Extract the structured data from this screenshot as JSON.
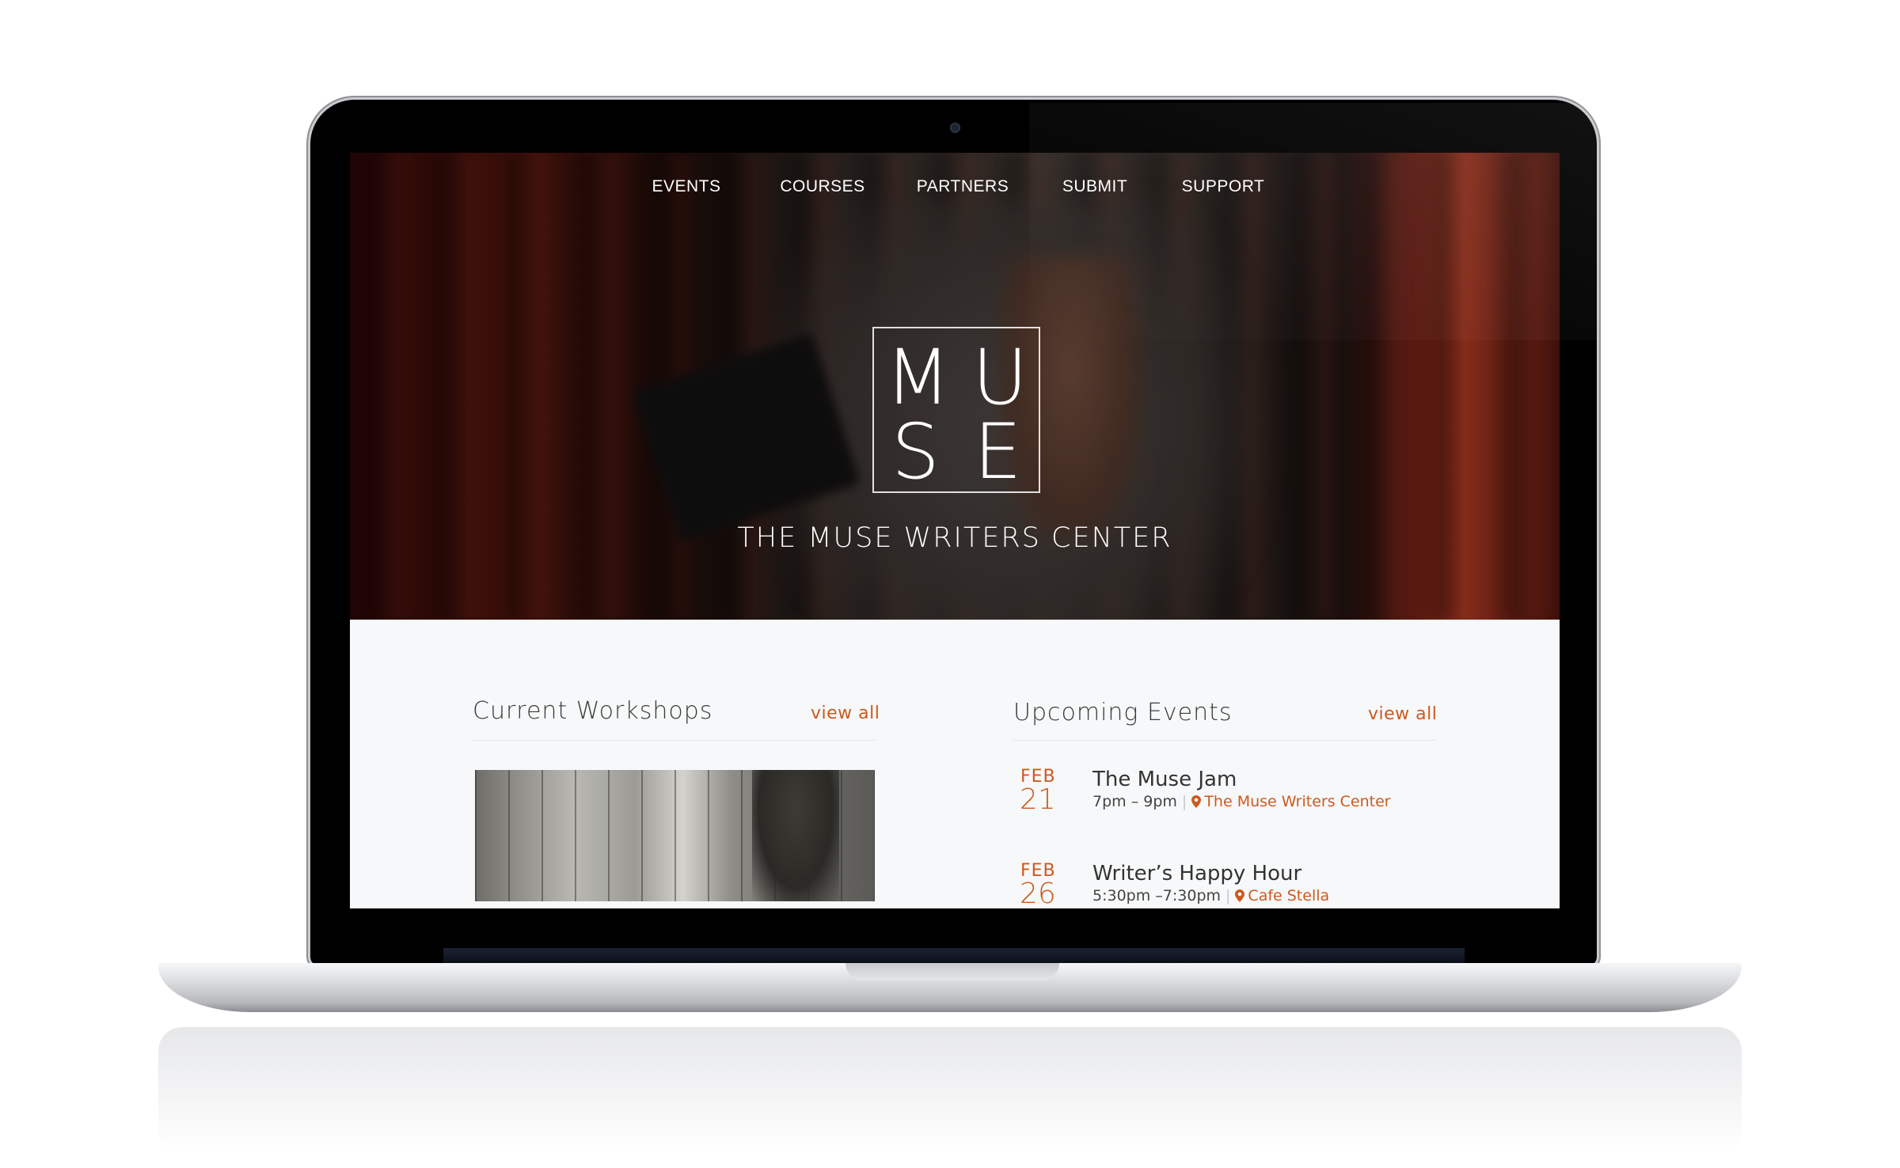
{
  "nav": {
    "items": [
      {
        "label": "EVENTS"
      },
      {
        "label": "COURSES"
      },
      {
        "label": "PARTNERS"
      },
      {
        "label": "SUBMIT"
      },
      {
        "label": "SUPPORT"
      }
    ]
  },
  "hero": {
    "logo_letters": [
      "M",
      "U",
      "S",
      "E"
    ],
    "title": "THE MUSE WRITERS CENTER"
  },
  "workshops": {
    "heading": "Current Workshops",
    "view_all": "view all"
  },
  "events": {
    "heading": "Upcoming Events",
    "view_all": "view all",
    "items": [
      {
        "month": "FEB",
        "day": "21",
        "title": "The Muse Jam",
        "time": "7pm – 9pm",
        "location": "The Muse Writers Center"
      },
      {
        "month": "FEB",
        "day": "26",
        "title": "Writer’s Happy Hour",
        "time": "5:30pm –7:30pm",
        "location": "Cafe Stella"
      }
    ]
  },
  "colors": {
    "accent": "#cc5a1f",
    "content_bg": "#f7f8f9",
    "text": "#333333"
  },
  "icons": {
    "location": "map-pin-icon"
  }
}
